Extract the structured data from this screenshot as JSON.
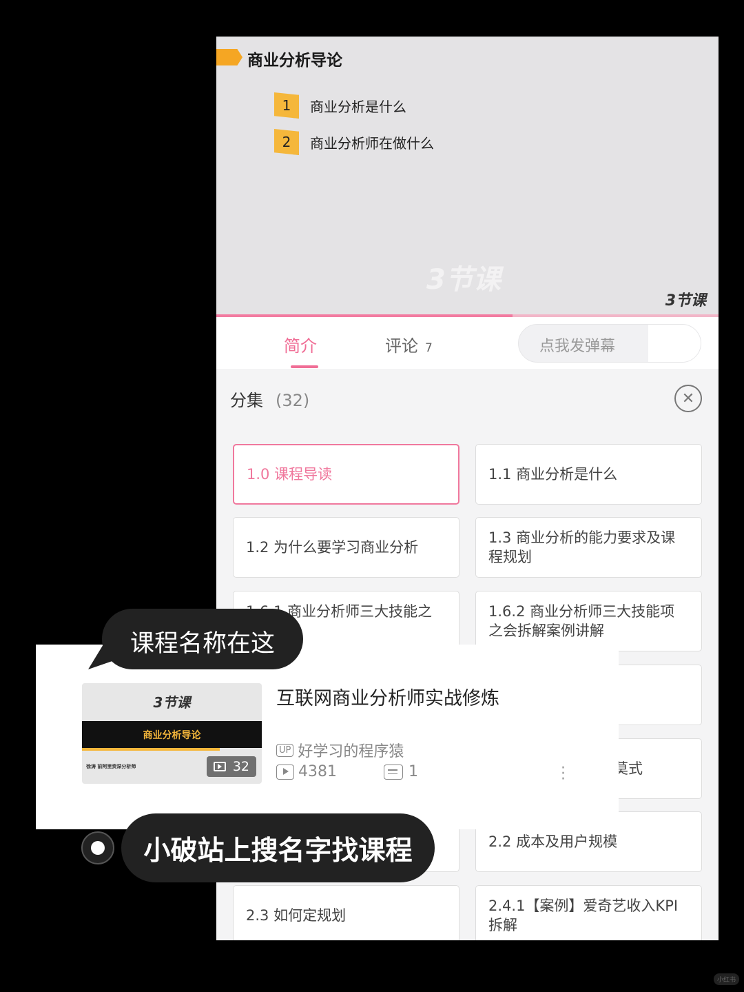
{
  "video": {
    "title": "商业分析导论",
    "toc": [
      {
        "num": "1",
        "text": "商业分析是什么"
      },
      {
        "num": "2",
        "text": "商业分析师在做什么"
      }
    ],
    "watermark": "3节课",
    "progress": 0.59
  },
  "tabs": {
    "intro": "简介",
    "comments": "评论",
    "comments_count": "7",
    "danmaku_placeholder": "点我发弹幕",
    "danmaku_icon_label": "弹"
  },
  "episodes": {
    "label": "分集",
    "count": "(32)",
    "items": [
      {
        "label": "1.0  课程导读",
        "active": true
      },
      {
        "label": "1.1  商业分析是什么"
      },
      {
        "label": "1.2  为什么要学习商业分析"
      },
      {
        "label": "1.3  商业分析的能力要求及课程规划"
      },
      {
        "label": "1.6.1  商业分析师三大技能之拆解"
      },
      {
        "label": "1.6.2  商业分析师三大技能项之会拆解案例讲解"
      },
      {
        "label": ""
      },
      {
        "label": ""
      },
      {
        "label": ""
      },
      {
        "label": "莫式"
      },
      {
        "label": ""
      },
      {
        "label": "2.2  成本及用户规模"
      },
      {
        "label": "2.3  如何定规划"
      },
      {
        "label": "2.4.1【案例】爱奇艺收入KPI拆解"
      }
    ]
  },
  "result": {
    "thumb_logo": "3节课",
    "thumb_band": "商业分析导论",
    "thumb_caption": "徐涛  前阿里资深分析师",
    "episode_badge": "32",
    "title": "互联网商业分析师实战修炼",
    "up_label": "UP",
    "uploader": "好学习的程序猿",
    "views": "4381",
    "danmaku": "1"
  },
  "bubbles": {
    "top": "课程名称在这",
    "bottom": "小破站上搜名字找课程"
  },
  "corner_mark": "小红书"
}
